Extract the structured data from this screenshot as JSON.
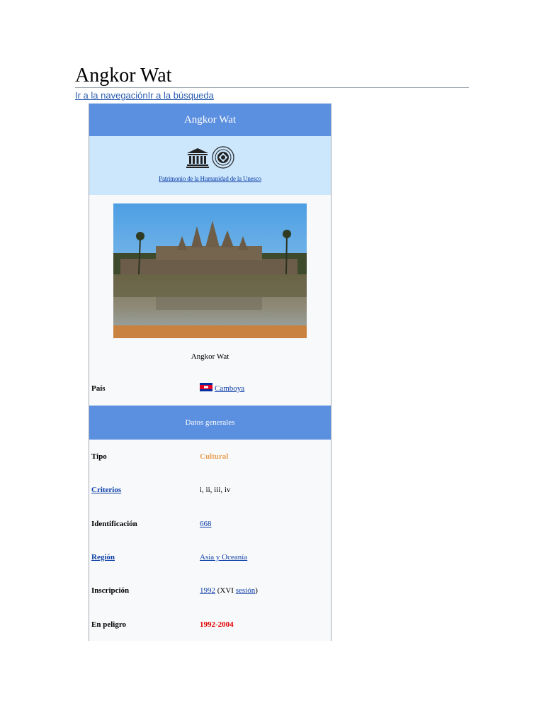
{
  "page": {
    "title": "Angkor Wat",
    "jump_links": "Ir a la navegaciónIr a la búsqueda"
  },
  "infobox": {
    "header": "Angkor Wat",
    "unesco_link": "Patrimonio de la Humanidad de la Unesco",
    "photo_caption": "Angkor Wat",
    "country": {
      "label": "País",
      "value": "Camboya",
      "flag_icon": "cambodia-flag-icon"
    },
    "section_title": "Datos generales",
    "rows": {
      "tipo": {
        "label": "Tipo",
        "value": "Cultural"
      },
      "criterios": {
        "label": "Criterios",
        "value": "i, ii, iii, iv"
      },
      "identificacion": {
        "label": "Identificación",
        "value": "668"
      },
      "region": {
        "label": "Región",
        "value": "Asia y Oceanía"
      },
      "inscripcion": {
        "label": "Inscripción",
        "year": "1992",
        "open": " (XVI ",
        "session": "sesión",
        "close": ")"
      },
      "peligro": {
        "label": "En peligro",
        "value": "1992-2004"
      }
    },
    "colors": {
      "header_bg": "#5b8fe0",
      "unesco_bg": "#cce6fc",
      "link": "#0b3ea8",
      "cultural": "#e8a055",
      "danger": "#e00000"
    }
  }
}
